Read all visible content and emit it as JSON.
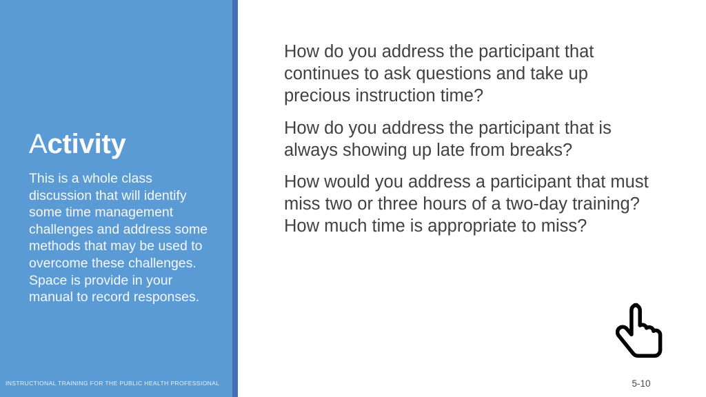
{
  "colors": {
    "panel_blue": "#5b9bd5",
    "panel_edge_blue": "#4470b5",
    "panel_text": "#f4f8fc",
    "body_text": "#414141",
    "slide_number_text": "#464646"
  },
  "left_panel": {
    "title_lead": "A",
    "title_rest": "ctivity",
    "title_full": "Activity",
    "body": "This is a whole class discussion that will identify some time management challenges and address some methods that may be used to overcome these challenges. Space is provide in your manual to record responses.",
    "footer": "INSTRUCTIONAL TRAINING FOR THE PUBLIC HEALTH PROFESSIONAL"
  },
  "content": {
    "questions": [
      "How do you address the participant that continues to ask questions and take up precious instruction time?",
      "How do you address the participant that is always showing up late from breaks?",
      "How would you address a participant that must miss two or three hours of a two-day training? How much time is appropriate to miss?"
    ]
  },
  "footer_right": {
    "hand_icon": "pointing-hand-icon",
    "slide_number": "5-10"
  }
}
